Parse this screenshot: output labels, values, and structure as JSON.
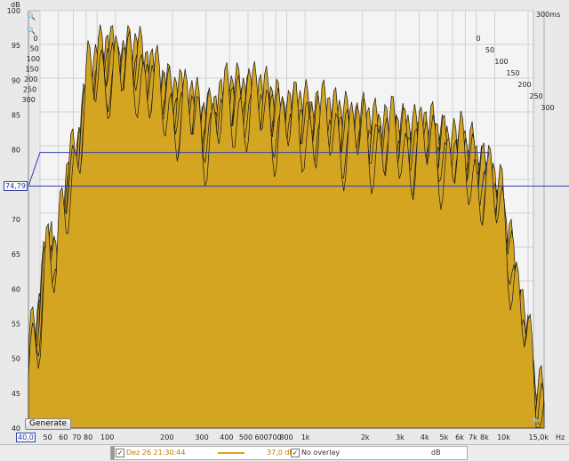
{
  "window": {
    "generate_label": "Generate",
    "time_max_label": "300ms",
    "y_unit": "dB",
    "x_unit": "Hz",
    "y_cursor_label": "74,79",
    "x_cursor_label": "40,0"
  },
  "legend": {
    "trace_name": "Dez 26 21:30:44",
    "trace_value": "37,0 dB",
    "overlay_label": "No overlay",
    "overlay_unit": "dB"
  },
  "chart_data": {
    "type": "area",
    "title": "",
    "subtitle": "",
    "chart_kind": "waterfall",
    "xlabel": "Hz",
    "ylabel": "dB",
    "x_scale": "log",
    "x_range": [
      40,
      16000
    ],
    "y_range": [
      40,
      100
    ],
    "z_axis": {
      "label": "ms",
      "ticks": [
        "0",
        "50",
        "100",
        "150",
        "200",
        "250",
        "300"
      ],
      "range_ms": [
        0,
        300
      ]
    },
    "x_ticks": [
      {
        "value": 40,
        "label": "40,0"
      },
      {
        "value": 50,
        "label": "50"
      },
      {
        "value": 60,
        "label": "60"
      },
      {
        "value": 70,
        "label": "70"
      },
      {
        "value": 80,
        "label": "80"
      },
      {
        "value": 100,
        "label": "100"
      },
      {
        "value": 200,
        "label": "200"
      },
      {
        "value": 300,
        "label": "300"
      },
      {
        "value": 400,
        "label": "400"
      },
      {
        "value": 500,
        "label": "500"
      },
      {
        "value": 600,
        "label": "600"
      },
      {
        "value": 700,
        "label": "700"
      },
      {
        "value": 800,
        "label": "800"
      },
      {
        "value": 1000,
        "label": "1k"
      },
      {
        "value": 2000,
        "label": "2k"
      },
      {
        "value": 3000,
        "label": "3k"
      },
      {
        "value": 4000,
        "label": "4k"
      },
      {
        "value": 5000,
        "label": "5k"
      },
      {
        "value": 6000,
        "label": "6k"
      },
      {
        "value": 7000,
        "label": "7k"
      },
      {
        "value": 8000,
        "label": "8k"
      },
      {
        "value": 10000,
        "label": "10k"
      },
      {
        "value": 15000,
        "label": "15,0k"
      }
    ],
    "y_ticks": [
      40,
      45,
      50,
      55,
      60,
      65,
      70,
      75,
      80,
      85,
      90,
      95,
      100
    ],
    "cursor_level_db": 74.79,
    "fill_color": "#d4a521",
    "line_color": "#1a1a1a",
    "front_slice_db": [
      [
        40,
        48
      ],
      [
        45,
        56
      ],
      [
        50,
        66
      ],
      [
        55,
        60
      ],
      [
        60,
        72
      ],
      [
        70,
        79
      ],
      [
        80,
        88
      ],
      [
        90,
        91
      ],
      [
        100,
        92
      ],
      [
        120,
        90
      ],
      [
        140,
        92
      ],
      [
        160,
        89
      ],
      [
        180,
        87
      ],
      [
        200,
        86
      ],
      [
        250,
        85
      ],
      [
        300,
        82
      ],
      [
        400,
        85
      ],
      [
        500,
        86
      ],
      [
        600,
        85
      ],
      [
        700,
        84
      ],
      [
        800,
        83
      ],
      [
        1000,
        83
      ],
      [
        1500,
        82
      ],
      [
        2000,
        81
      ],
      [
        3000,
        80
      ],
      [
        4000,
        80
      ],
      [
        5000,
        79
      ],
      [
        6000,
        78
      ],
      [
        7000,
        77
      ],
      [
        8000,
        75
      ],
      [
        10000,
        70
      ],
      [
        12000,
        58
      ],
      [
        15000,
        42
      ]
    ],
    "grid": true
  },
  "zoom": {
    "plus": "+",
    "minus": "−"
  }
}
